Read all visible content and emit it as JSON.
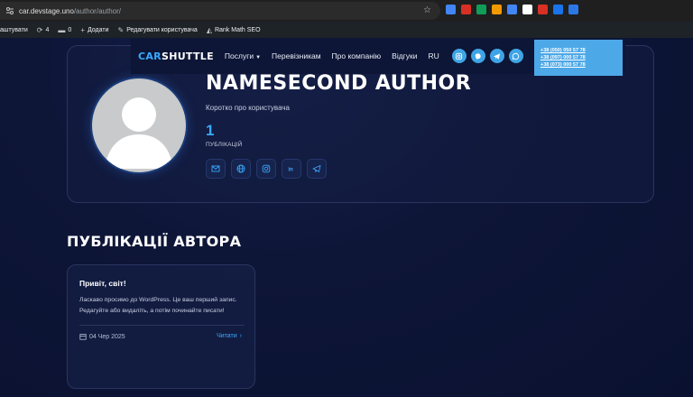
{
  "browser": {
    "url_host": "car.devstage.uno",
    "url_path": "/author/author/",
    "extension_colors": [
      "#4285f4",
      "#d93025",
      "#0f9d58",
      "#f29900",
      "#4285f4",
      "#ffffff",
      "#d93025",
      "#1a73e8",
      "#2b78e4"
    ]
  },
  "admin_bar": {
    "items": [
      {
        "icon": "customize-icon",
        "label": "аштувати"
      },
      {
        "icon": "updates-icon",
        "label": "4"
      },
      {
        "icon": "comments-icon",
        "label": "0"
      },
      {
        "icon": "plus-icon",
        "label": "Додати"
      },
      {
        "icon": "pencil-icon",
        "label": "Редагувати користувача"
      },
      {
        "icon": "rankmath-icon",
        "label": "Rank Math SEO"
      }
    ]
  },
  "nav": {
    "logo_car": "CAR",
    "logo_shuttle": "SHUTTLE",
    "menu": [
      "Послуги",
      "Перевізникам",
      "Про компанію",
      "Відгуки",
      "RU"
    ],
    "socials": [
      "instagram-icon",
      "viber-icon",
      "telegram-icon",
      "whatsapp-icon"
    ],
    "phones": [
      "+38 (050) 050 57 78",
      "+38 (097) 000 57 78",
      "+38 (073) 000 57 78"
    ]
  },
  "profile": {
    "name": "NAMESECOND AUTHOR",
    "bio": "Коротко про користувача",
    "publications_count": "1",
    "publications_label": "ПУБЛІКАЦІЙ",
    "contacts": [
      "email-icon",
      "globe-icon",
      "instagram-icon",
      "linkedin-icon",
      "telegram-icon"
    ]
  },
  "section": {
    "title": "ПУБЛІКАЦІЇ АВТОРА"
  },
  "post": {
    "title": "Привіт, світ!",
    "text": "Ласкаво просимо до WordPress. Це ваш перший запис. Редагуйте або видаліть, а потім починайте писати!",
    "date": "04 Чер 2025",
    "read_label": "Читати",
    "read_arrow": "›"
  },
  "colors": {
    "accent": "#3aa9ff",
    "background": "#0b1230",
    "phone_box": "#4da8e8"
  }
}
